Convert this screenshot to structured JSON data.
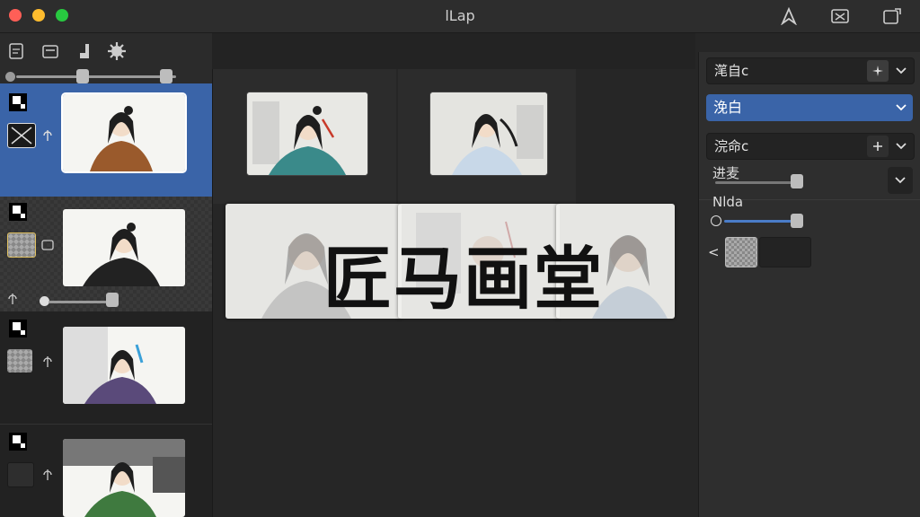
{
  "window": {
    "title": "lLap"
  },
  "panel": {
    "field1": {
      "value": "滗自c"
    },
    "blend_mode": {
      "selected": "浼白"
    },
    "field2": {
      "value": "浣命c"
    },
    "label1": "进麦",
    "label2": "Nlda",
    "back_symbol": "<"
  },
  "banner": {
    "text": "匠马画堂"
  },
  "colors": {
    "accent": "#3a64a8",
    "background": "#262626",
    "panel": "#2e2e2e"
  }
}
